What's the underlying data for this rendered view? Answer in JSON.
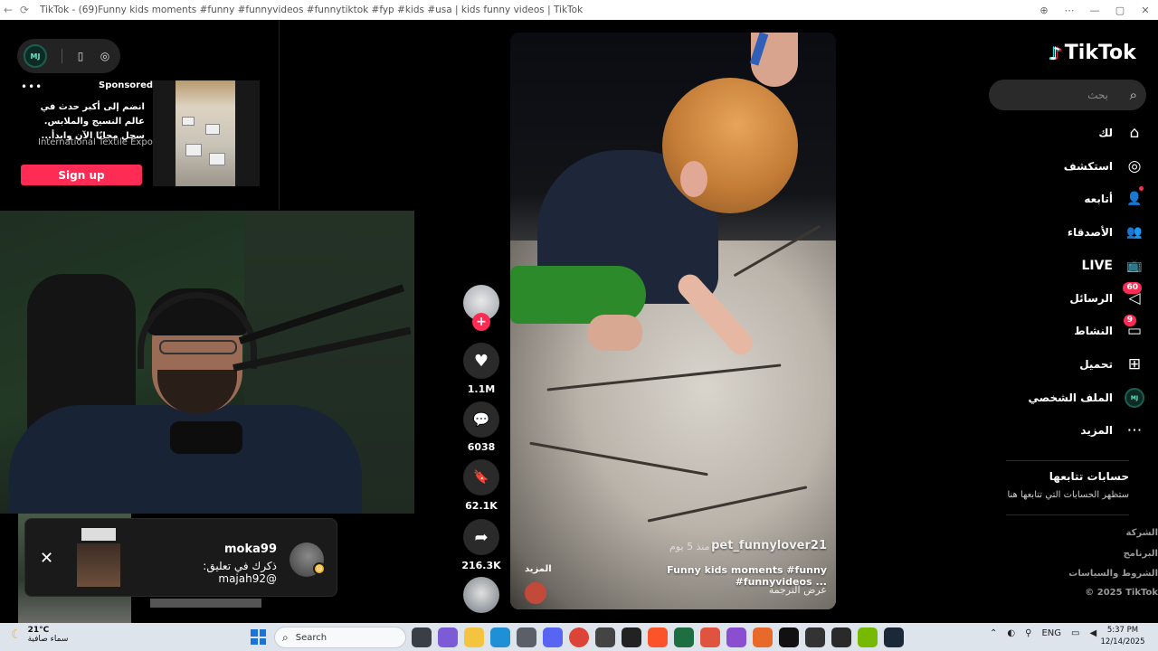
{
  "browser": {
    "title": "TikTok - (69)Funny kids moments #funny #funnyvideos #funnytiktok #fyp #kids #usa | kids funny videos | TikTok",
    "back": "←",
    "refresh": "⟳",
    "controls": [
      "⊕",
      "⋯",
      "—",
      "▢",
      "✕"
    ]
  },
  "mini_controls": {
    "avatar_text": "MJ",
    "icon1": "▯",
    "icon2": "◎"
  },
  "ad": {
    "more": "•••",
    "sponsored": "Sponsored",
    "text": "انضم إلى أكبر حدث في عالم النسيج والملابس. سجل مجانًا الآن وابدأ...",
    "brand": "International Textile Expo",
    "cta": "Sign up"
  },
  "notification": {
    "close": "✕",
    "user": "moka99",
    "message": "ذكرك في تعليق: @majah92",
    "badge": "@"
  },
  "rail": {
    "follow": "+",
    "like_icon": "♥",
    "likes": "1.1M",
    "comment_icon": "💬",
    "comments": "6038",
    "save_icon": "🔖",
    "saves": "62.1K",
    "share_icon": "➦",
    "shares": "216.3K"
  },
  "video": {
    "author": "pet_funnylover21",
    "time": "منذ 5 يوم",
    "caption": "Funny kids moments #funny #funnyvideos ...",
    "more": "المزيد",
    "translate": "عرض الترجمة"
  },
  "sidebar": {
    "logo_text": "TikTok",
    "logo_mark": "♪",
    "search_placeholder": "بحث",
    "search_icon": "⌕",
    "items": [
      {
        "label": "لك",
        "icon": "⌂"
      },
      {
        "label": "استكشف",
        "icon": "◎"
      },
      {
        "label": "أتابعه",
        "icon": "👤"
      },
      {
        "label": "الأصدقاء",
        "icon": "👥"
      },
      {
        "label": "LIVE",
        "icon": "📺"
      },
      {
        "label": "الرسائل",
        "icon": "◁",
        "badge": "60"
      },
      {
        "label": "النشاط",
        "icon": "▭",
        "badge": "9"
      },
      {
        "label": "تحميل",
        "icon": "⊞"
      },
      {
        "label": "الملف الشخصي",
        "avatar": "MJ"
      },
      {
        "label": "المزيد",
        "icon": "⋯"
      }
    ],
    "following_title": "حسابات تتابعها",
    "following_sub": "ستظهر الحسابات التي تتابعها هنا",
    "footer": [
      "الشركة",
      "البرنامج",
      "الشروط والسياسات",
      "© 2025 TikTok"
    ]
  },
  "taskbar": {
    "temp": "21°C",
    "weather": "سماء صافية",
    "search_placeholder": "Search",
    "lang": "ENG",
    "time": "5:37 PM",
    "date": "12/14/2025"
  },
  "colors": {
    "accent": "#fe2c55",
    "cyan": "#25f4ee"
  }
}
